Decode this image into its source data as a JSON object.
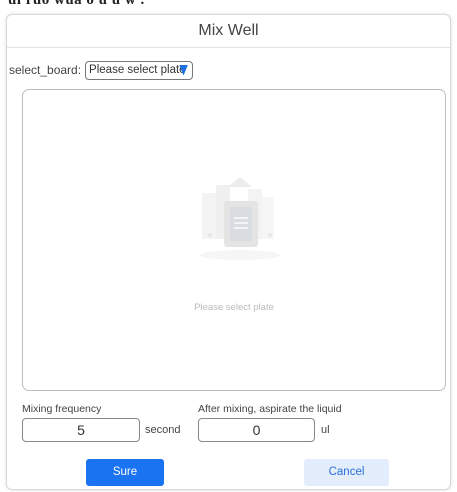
{
  "page_fragment": "ul ruo wua o u u w .",
  "dialog": {
    "title": "Mix Well"
  },
  "board": {
    "label": "select_board:",
    "select_value": "Please select plate",
    "caret_color": "#1e6fe0"
  },
  "plate_panel": {
    "empty_text": "Please select plate"
  },
  "mixing_frequency": {
    "label": "Mixing frequency",
    "value": "5",
    "unit": "second"
  },
  "aspirate": {
    "label": "After mixing, aspirate the liquid",
    "value": "0",
    "unit": "ul"
  },
  "buttons": {
    "sure": "Sure",
    "cancel": "Cancel"
  },
  "colors": {
    "primary": "#1a73f0",
    "cancel_bg": "#e3edfb",
    "cancel_text": "#2b6fd6"
  }
}
